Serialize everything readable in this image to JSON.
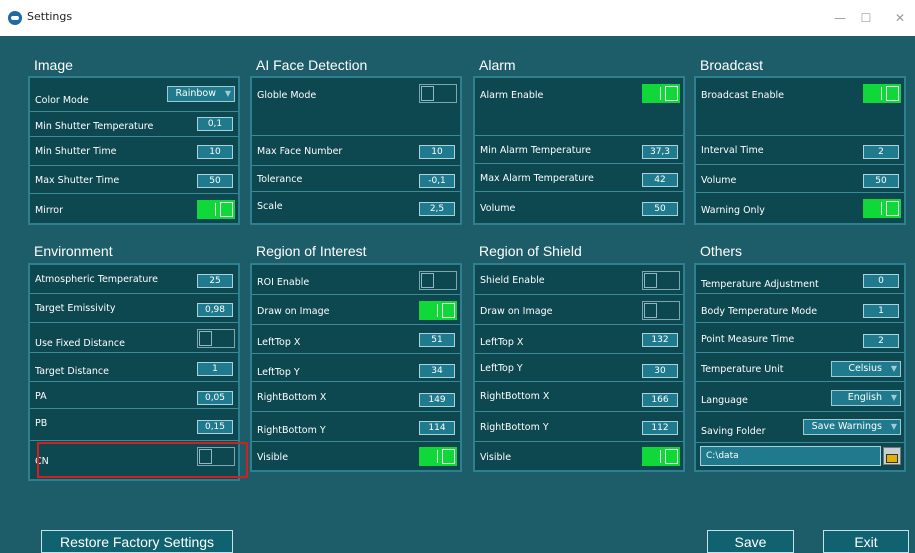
{
  "window": {
    "title": "Settings",
    "controls": {
      "minimize": "—",
      "maximize": "☐",
      "close": "✕"
    }
  },
  "sections": {
    "image": {
      "title": "Image",
      "color_mode": {
        "label": "Color Mode",
        "value": "Rainbow"
      },
      "min_shutter_temp": {
        "label": "Min Shutter Temperature",
        "value": "0,1"
      },
      "min_shutter_time": {
        "label": "Min Shutter Time",
        "value": "10"
      },
      "max_shutter_time": {
        "label": "Max Shutter Time",
        "value": "50"
      },
      "mirror": {
        "label": "Mirror",
        "state": "on"
      }
    },
    "ai_face": {
      "title": "AI Face Detection",
      "globle_mode": {
        "label": "Globle Mode",
        "state": "off"
      },
      "max_face_number": {
        "label": "Max Face Number",
        "value": "10"
      },
      "tolerance": {
        "label": "Tolerance",
        "value": "-0,1"
      },
      "scale": {
        "label": "Scale",
        "value": "2,5"
      }
    },
    "alarm": {
      "title": "Alarm",
      "alarm_enable": {
        "label": "Alarm Enable",
        "state": "on"
      },
      "min_alarm_temp": {
        "label": "Min Alarm Temperature",
        "value": "37,3"
      },
      "max_alarm_temp": {
        "label": "Max Alarm Temperature",
        "value": "42"
      },
      "volume": {
        "label": "Volume",
        "value": "50"
      }
    },
    "broadcast": {
      "title": "Broadcast",
      "broadcast_enable": {
        "label": "Broadcast Enable",
        "state": "on"
      },
      "interval_time": {
        "label": "Interval Time",
        "value": "2"
      },
      "volume": {
        "label": "Volume",
        "value": "50"
      },
      "warning_only": {
        "label": "Warning Only",
        "state": "on"
      }
    },
    "environment": {
      "title": "Environment",
      "atmospheric_temp": {
        "label": "Atmospheric Temperature",
        "value": "25"
      },
      "target_emissivity": {
        "label": "Target Emissivity",
        "value": "0,98"
      },
      "use_fixed_distance": {
        "label": "Use Fixed Distance",
        "state": "off"
      },
      "target_distance": {
        "label": "Target Distance",
        "value": "1"
      },
      "pa": {
        "label": "PA",
        "value": "0,05"
      },
      "pb": {
        "label": "PB",
        "value": "0,15"
      },
      "cn": {
        "label": "CN",
        "state": "off"
      }
    },
    "roi": {
      "title": "Region of Interest",
      "roi_enable": {
        "label": "ROI Enable",
        "state": "off"
      },
      "draw_on_image": {
        "label": "Draw on Image",
        "state": "on"
      },
      "lefttop_x": {
        "label": "LeftTop X",
        "value": "51"
      },
      "lefttop_y": {
        "label": "LeftTop Y",
        "value": "34"
      },
      "rightbottom_x": {
        "label": "RightBottom X",
        "value": "149"
      },
      "rightbottom_y": {
        "label": "RightBottom Y",
        "value": "114"
      },
      "visible": {
        "label": "Visible",
        "state": "on"
      }
    },
    "shield": {
      "title": "Region of Shield",
      "shield_enable": {
        "label": "Shield Enable",
        "state": "off"
      },
      "draw_on_image": {
        "label": "Draw on Image",
        "state": "off"
      },
      "lefttop_x": {
        "label": "LeftTop X",
        "value": "132"
      },
      "lefttop_y": {
        "label": "LeftTop Y",
        "value": "30"
      },
      "rightbottom_x": {
        "label": "RightBottom X",
        "value": "166"
      },
      "rightbottom_y": {
        "label": "RightBottom Y",
        "value": "112"
      },
      "visible": {
        "label": "Visible",
        "state": "on"
      }
    },
    "others": {
      "title": "Others",
      "temp_adjustment": {
        "label": "Temperature Adjustment",
        "value": "0"
      },
      "body_temp_mode": {
        "label": "Body Temperature Mode",
        "value": "1"
      },
      "point_measure_time": {
        "label": "Point Measure Time",
        "value": "2"
      },
      "temp_unit": {
        "label": "Temperature Unit",
        "value": "Celsius"
      },
      "language": {
        "label": "Language",
        "value": "English"
      },
      "saving_folder": {
        "label": "Saving Folder",
        "value": "Save Warnings"
      },
      "folder_path": {
        "value": "C:\\data"
      }
    }
  },
  "buttons": {
    "restore": "Restore Factory Settings",
    "save": "Save",
    "exit": "Exit"
  },
  "colors": {
    "background": "#1d5d69",
    "panel": "#0d4750",
    "toggle_on": "#10d838",
    "highlight": "#d21f1f"
  }
}
